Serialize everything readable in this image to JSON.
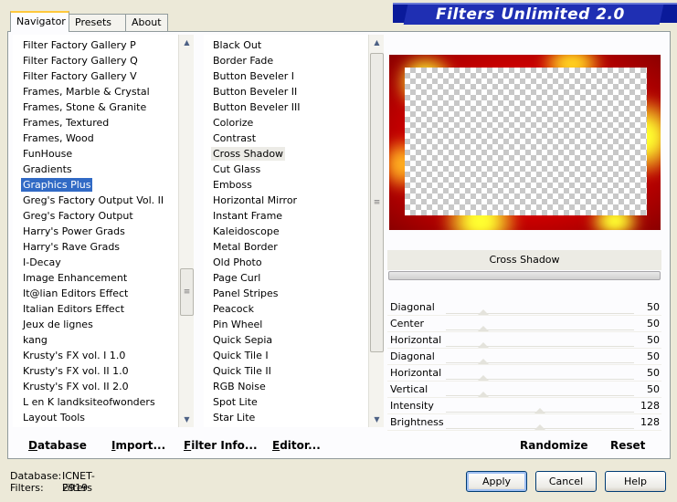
{
  "tabs": [
    {
      "label": "Navigator",
      "active": true
    },
    {
      "label": "Presets",
      "active": false
    },
    {
      "label": "About",
      "active": false
    }
  ],
  "banner": {
    "title": "Filters Unlimited 2.0"
  },
  "categories": {
    "selected": "Graphics Plus",
    "items": [
      "Filter Factory Gallery P",
      "Filter Factory Gallery Q",
      "Filter Factory Gallery V",
      "Frames, Marble & Crystal",
      "Frames, Stone & Granite",
      "Frames, Textured",
      "Frames, Wood",
      "FunHouse",
      "Gradients",
      "Graphics Plus",
      "Greg's Factory Output Vol. II",
      "Greg's Factory Output",
      "Harry's Power Grads",
      "Harry's Rave Grads",
      "I-Decay",
      "Image Enhancement",
      "It@lian Editors Effect",
      "Italian Editors Effect",
      "Jeux de lignes",
      "kang",
      "Krusty's FX vol. I 1.0",
      "Krusty's FX vol. II 1.0",
      "Krusty's FX vol. II 2.0",
      "L en K landksiteofwonders",
      "Layout Tools"
    ]
  },
  "filters": {
    "selected": "Cross Shadow",
    "items": [
      "Black Out",
      "Border Fade",
      "Button Beveler I",
      "Button Beveler II",
      "Button Beveler III",
      "Colorize",
      "Contrast",
      "Cross Shadow",
      "Cut Glass",
      "Emboss",
      "Horizontal Mirror",
      "Instant Frame",
      "Kaleidoscope",
      "Metal Border",
      "Old Photo",
      "Page Curl",
      "Panel Stripes",
      "Peacock",
      "Pin Wheel",
      "Quick Sepia",
      "Quick Tile I",
      "Quick Tile II",
      "RGB Noise",
      "Spot Lite",
      "Star Lite"
    ]
  },
  "bottom_left_buttons": {
    "database": "Database",
    "import": "Import...",
    "filter_info": "Filter Info...",
    "editor": "Editor..."
  },
  "filter_name": "Cross Shadow",
  "parameters": [
    {
      "label": "Diagonal",
      "value": "50",
      "level": 0.2
    },
    {
      "label": "Center",
      "value": "50",
      "level": 0.2
    },
    {
      "label": "Horizontal",
      "value": "50",
      "level": 0.2
    },
    {
      "label": "Diagonal",
      "value": "50",
      "level": 0.2
    },
    {
      "label": "Horizontal",
      "value": "50",
      "level": 0.2
    },
    {
      "label": "Vertical",
      "value": "50",
      "level": 0.2
    },
    {
      "label": "Intensity",
      "value": "128",
      "level": 0.5
    },
    {
      "label": "Brightness",
      "value": "128",
      "level": 0.5
    }
  ],
  "right_buttons": {
    "randomize": "Randomize",
    "reset": "Reset"
  },
  "status": {
    "database_label": "Database:",
    "database_value": "ICNET-Filters",
    "filters_label": "Filters:",
    "filters_value": "2919"
  },
  "dialog_buttons": {
    "apply": "Apply",
    "cancel": "Cancel",
    "help": "Help"
  },
  "icons": {
    "scroll_up": "arrow-up-icon",
    "scroll_down": "arrow-down-icon",
    "grip": "grip-icon"
  },
  "colors": {
    "selection": "#316ac5",
    "banner": "#1f2fb3",
    "tab_accent": "#ffc83c"
  }
}
